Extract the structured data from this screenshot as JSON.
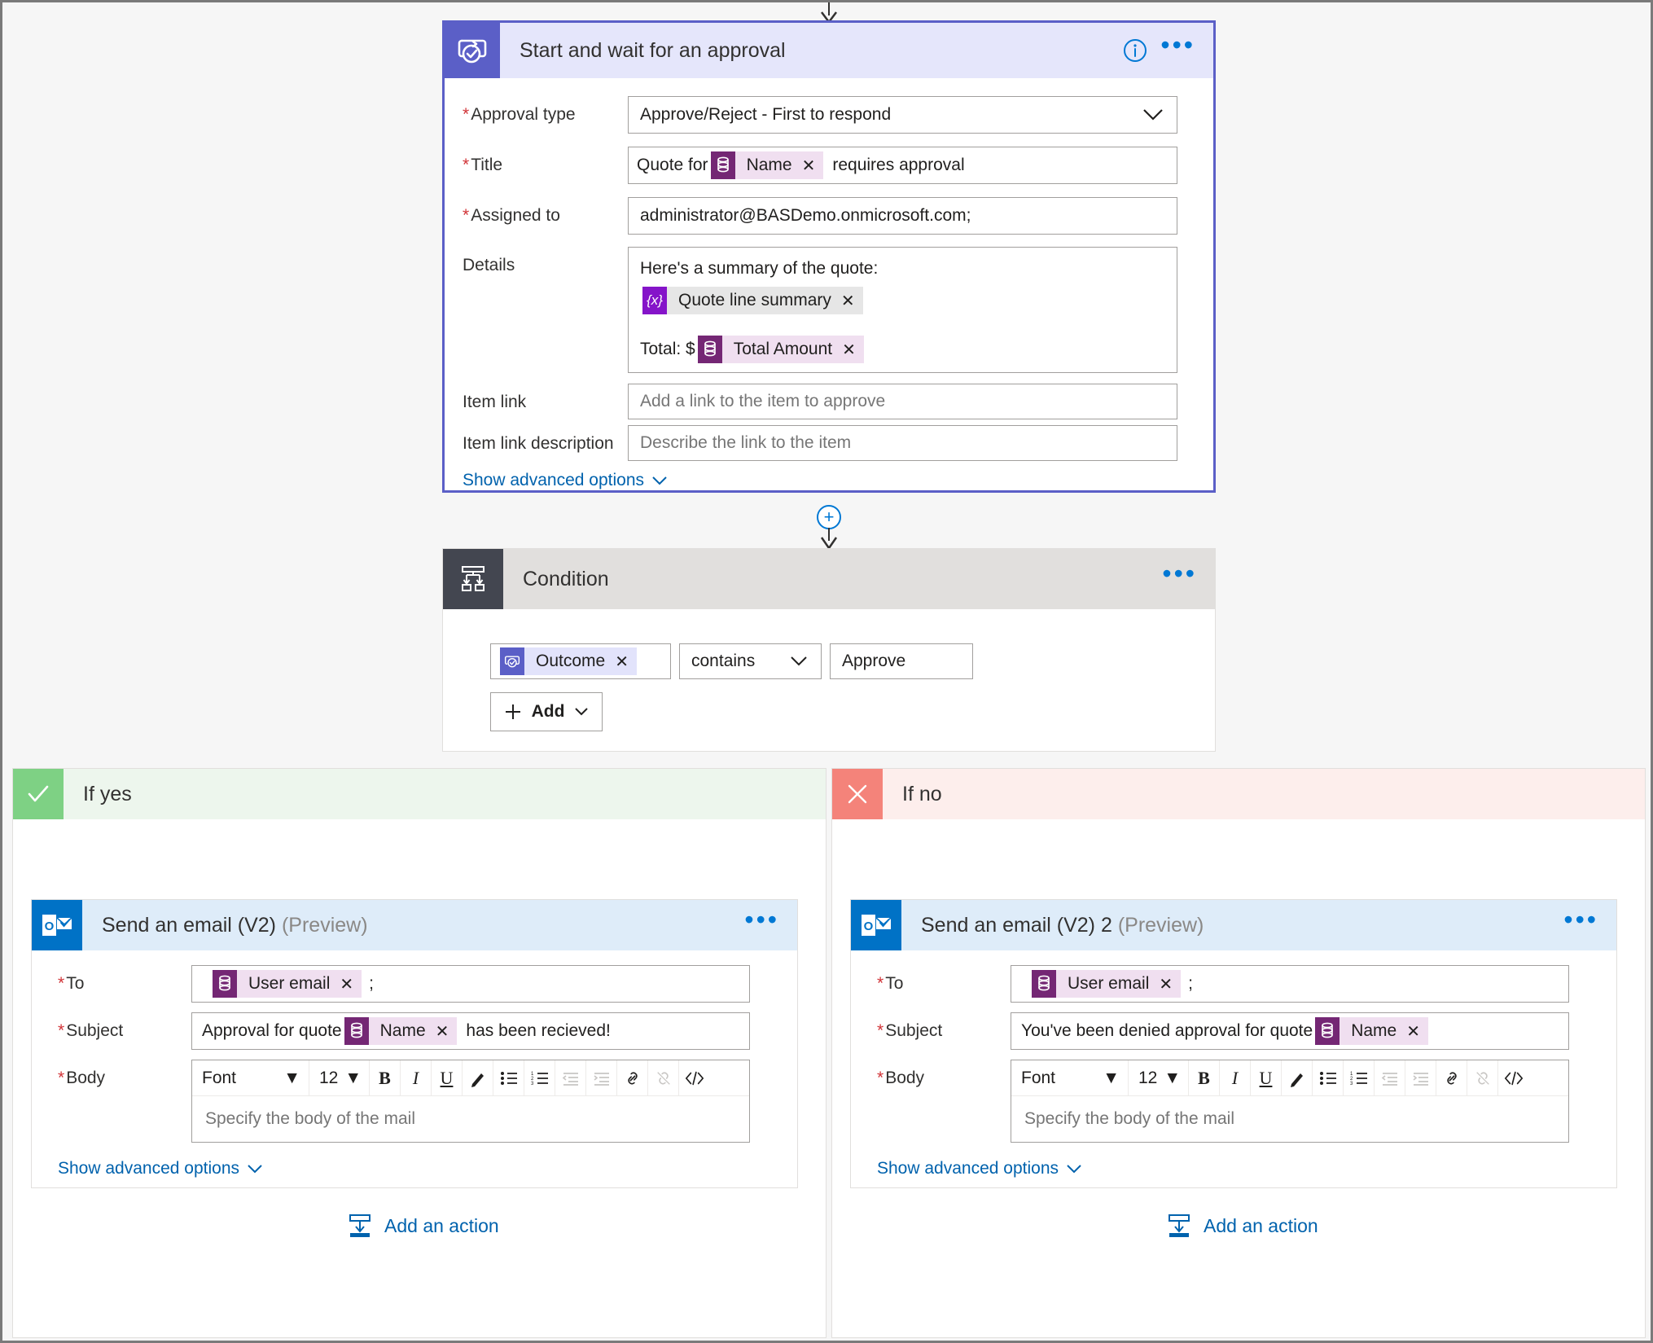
{
  "approval": {
    "title": "Start and wait for an approval",
    "info_icon": "info-icon",
    "more_icon": "ellipsis-icon",
    "fields": {
      "approval_type": {
        "label": "Approval type",
        "required": true,
        "value": "Approve/Reject - First to respond"
      },
      "title": {
        "label": "Title",
        "required": true,
        "text_before": "Quote for",
        "token": "Name",
        "text_after": "requires approval"
      },
      "assigned_to": {
        "label": "Assigned to",
        "required": true,
        "value": "administrator@BASDemo.onmicrosoft.com;"
      },
      "details": {
        "label": "Details",
        "required": false,
        "line1": "Here's a summary of the quote:",
        "token1": "Quote line summary",
        "token1_glyph": "{x}",
        "line2": "Total: $",
        "token2": "Total Amount"
      },
      "item_link": {
        "label": "Item link",
        "placeholder": "Add a link to the item to approve"
      },
      "item_link_description": {
        "label": "Item link description",
        "placeholder": "Describe the link to the item"
      }
    },
    "show_advanced": "Show advanced options"
  },
  "condition": {
    "title": "Condition",
    "more_icon": "ellipsis-icon",
    "left_token": "Outcome",
    "operator": "contains",
    "right_value": "Approve",
    "add_button": "Add"
  },
  "branch_yes": {
    "header": "If yes",
    "header_icon": "checkmark-icon",
    "add_action": "Add an action",
    "email": {
      "title": "Send an email (V2)",
      "preview": "(Preview)",
      "more_icon": "ellipsis-icon",
      "to": {
        "label": "To",
        "required": true,
        "token": "User email",
        "suffix": ";"
      },
      "subject": {
        "label": "Subject",
        "required": true,
        "text_before": "Approval for quote",
        "token": "Name",
        "text_after": "has been recieved!"
      },
      "body": {
        "label": "Body",
        "required": true,
        "font_name": "Font",
        "font_size": "12",
        "placeholder": "Specify the body of the mail"
      },
      "show_advanced": "Show advanced options"
    }
  },
  "branch_no": {
    "header": "If no",
    "header_icon": "close-icon",
    "add_action": "Add an action",
    "email": {
      "title": "Send an email (V2) 2",
      "preview": "(Preview)",
      "more_icon": "ellipsis-icon",
      "to": {
        "label": "To",
        "required": true,
        "token": "User email",
        "suffix": ";"
      },
      "subject": {
        "label": "Subject",
        "required": true,
        "text_before": "You've been denied approval for quote",
        "token": "Name",
        "text_after": ""
      },
      "body": {
        "label": "Body",
        "required": true,
        "font_name": "Font",
        "font_size": "12",
        "placeholder": "Specify the body of the mail"
      },
      "show_advanced": "Show advanced options"
    }
  },
  "toolbar_icons": [
    "bold-icon",
    "italic-icon",
    "underline-icon",
    "text-color-icon",
    "bulleted-list-icon",
    "numbered-list-icon",
    "decrease-indent-icon",
    "increase-indent-icon",
    "insert-link-icon",
    "remove-link-icon",
    "code-view-icon"
  ],
  "colors": {
    "approval_accent": "#5b5fc7",
    "condition_accent": "#434650",
    "outlook_blue": "#0072c6",
    "yes_green": "#7ed184",
    "no_red": "#f4837a",
    "link_blue": "#0062ad",
    "token_purple": "#742774",
    "required_red": "#d13438"
  }
}
